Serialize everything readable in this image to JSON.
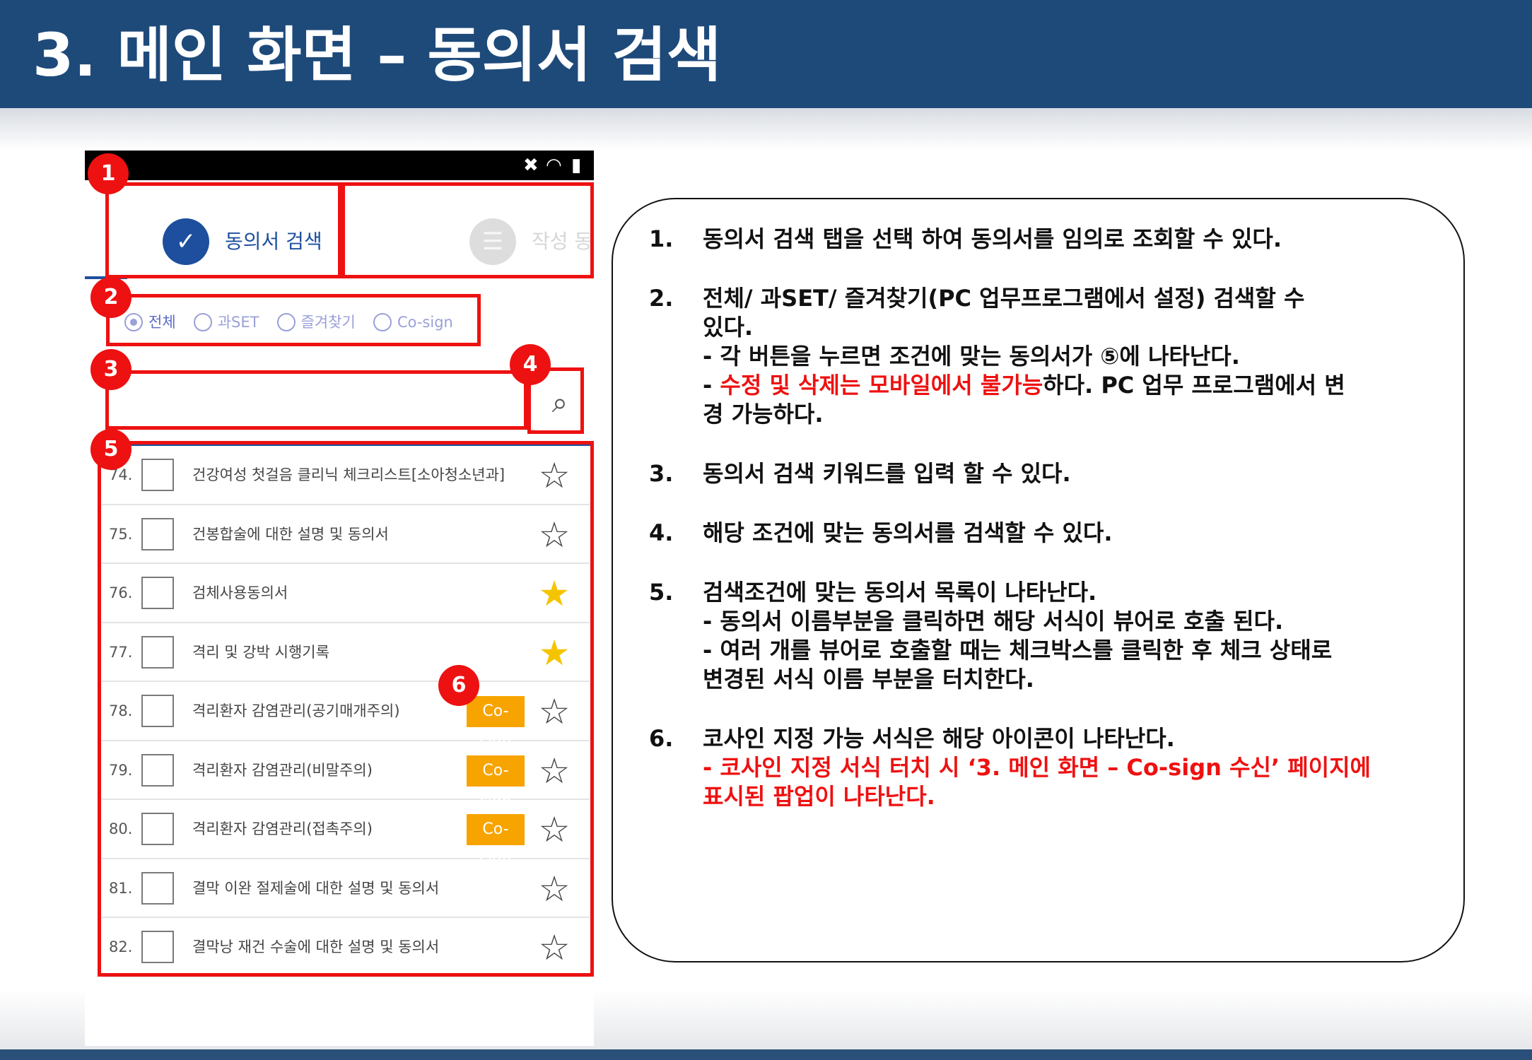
{
  "slide": {
    "title": "3. 메인 화면 – 동의서 검색"
  },
  "phone": {
    "status_icons": [
      "mute-icon",
      "wifi-icon",
      "battery-icon"
    ],
    "tabs": [
      {
        "label": "동의서 검색",
        "icon": "check-circle-icon",
        "selected": true
      },
      {
        "label": "작성 동의서",
        "icon": "stack-icon",
        "selected": false
      }
    ],
    "filters": [
      {
        "label": "전체",
        "checked": true
      },
      {
        "label": "과SET",
        "checked": false
      },
      {
        "label": "즐겨찾기",
        "checked": false
      },
      {
        "label": "Co-sign",
        "checked": false
      }
    ],
    "search": {
      "value": "",
      "icon": "search-icon"
    },
    "list": [
      {
        "num": "74.",
        "title": "건강여성 첫걸음 클리닉 체크리스트[소아청소년과]",
        "cosign": "",
        "favorite": false
      },
      {
        "num": "75.",
        "title": "건봉합술에 대한 설명 및 동의서",
        "cosign": "",
        "favorite": false
      },
      {
        "num": "76.",
        "title": "검체사용동의서",
        "cosign": "",
        "favorite": true
      },
      {
        "num": "77.",
        "title": "격리 및 강박 시행기록",
        "cosign": "",
        "favorite": true
      },
      {
        "num": "78.",
        "title": "격리환자 감염관리(공기매개주의)",
        "cosign": "Co-sign",
        "favorite": false
      },
      {
        "num": "79.",
        "title": "격리환자 감염관리(비말주의)",
        "cosign": "Co-sign",
        "favorite": false
      },
      {
        "num": "80.",
        "title": "격리환자 감염관리(접촉주의)",
        "cosign": "Co-sign",
        "favorite": false
      },
      {
        "num": "81.",
        "title": "결막 이완 절제술에 대한 설명 및 동의서",
        "cosign": "",
        "favorite": false
      },
      {
        "num": "82.",
        "title": "결막낭 재건 수술에 대한 설명 및 동의서",
        "cosign": "",
        "favorite": false
      }
    ]
  },
  "badges": [
    "1",
    "2",
    "3",
    "4",
    "5",
    "6"
  ],
  "description": [
    {
      "num": "1.",
      "lines": [
        {
          "text": "동의서 검색 탭을 선택 하여 동의서를 임의로 조회할 수 있다."
        }
      ]
    },
    {
      "num": "2.",
      "lines": [
        {
          "text": "전체/ 과SET/ 즐겨찾기(PC 업무프로그램에서 설정) 검색할 수"
        },
        {
          "text": "있다."
        },
        {
          "text": "- 각 버튼을 누르면 조건에 맞는 동의서가 ⑤에 나타난다."
        },
        {
          "prefix": "- ",
          "red": "수정 및 삭제는 모바일에서 불가능",
          "suffix": "하다. PC 업무 프로그램에서 변"
        },
        {
          "text": "경 가능하다."
        }
      ]
    },
    {
      "num": "3.",
      "lines": [
        {
          "text": "동의서 검색 키워드를 입력 할 수 있다."
        }
      ]
    },
    {
      "num": "4.",
      "lines": [
        {
          "text": "해당 조건에 맞는 동의서를 검색할 수 있다."
        }
      ]
    },
    {
      "num": "5.",
      "lines": [
        {
          "text": "검색조건에 맞는 동의서 목록이 나타난다."
        },
        {
          "text": "- 동의서 이름부분을 클릭하면 해당 서식이 뷰어로 호출 된다."
        },
        {
          "text": "- 여러 개를 뷰어로 호출할 때는 체크박스를 클릭한 후 체크 상태로"
        },
        {
          "text": "변경된 서식 이름 부분을 터치한다."
        }
      ]
    },
    {
      "num": "6.",
      "lines": [
        {
          "text": "코사인 지정 가능 서식은 해당 아이콘이 나타난다."
        },
        {
          "red_full": "- 코사인 지정 서식 터치 시 ‘3. 메인 화면 – Co-sign 수신’ 페이지에"
        },
        {
          "red_full": "표시된 팝업이 나타난다."
        }
      ]
    }
  ],
  "colors": {
    "title_bar": "#1e4a7a",
    "highlight": "#ee1111",
    "accent": "#1d4f9e",
    "cosign": "#f7a400",
    "star_on": "#f5c400"
  }
}
